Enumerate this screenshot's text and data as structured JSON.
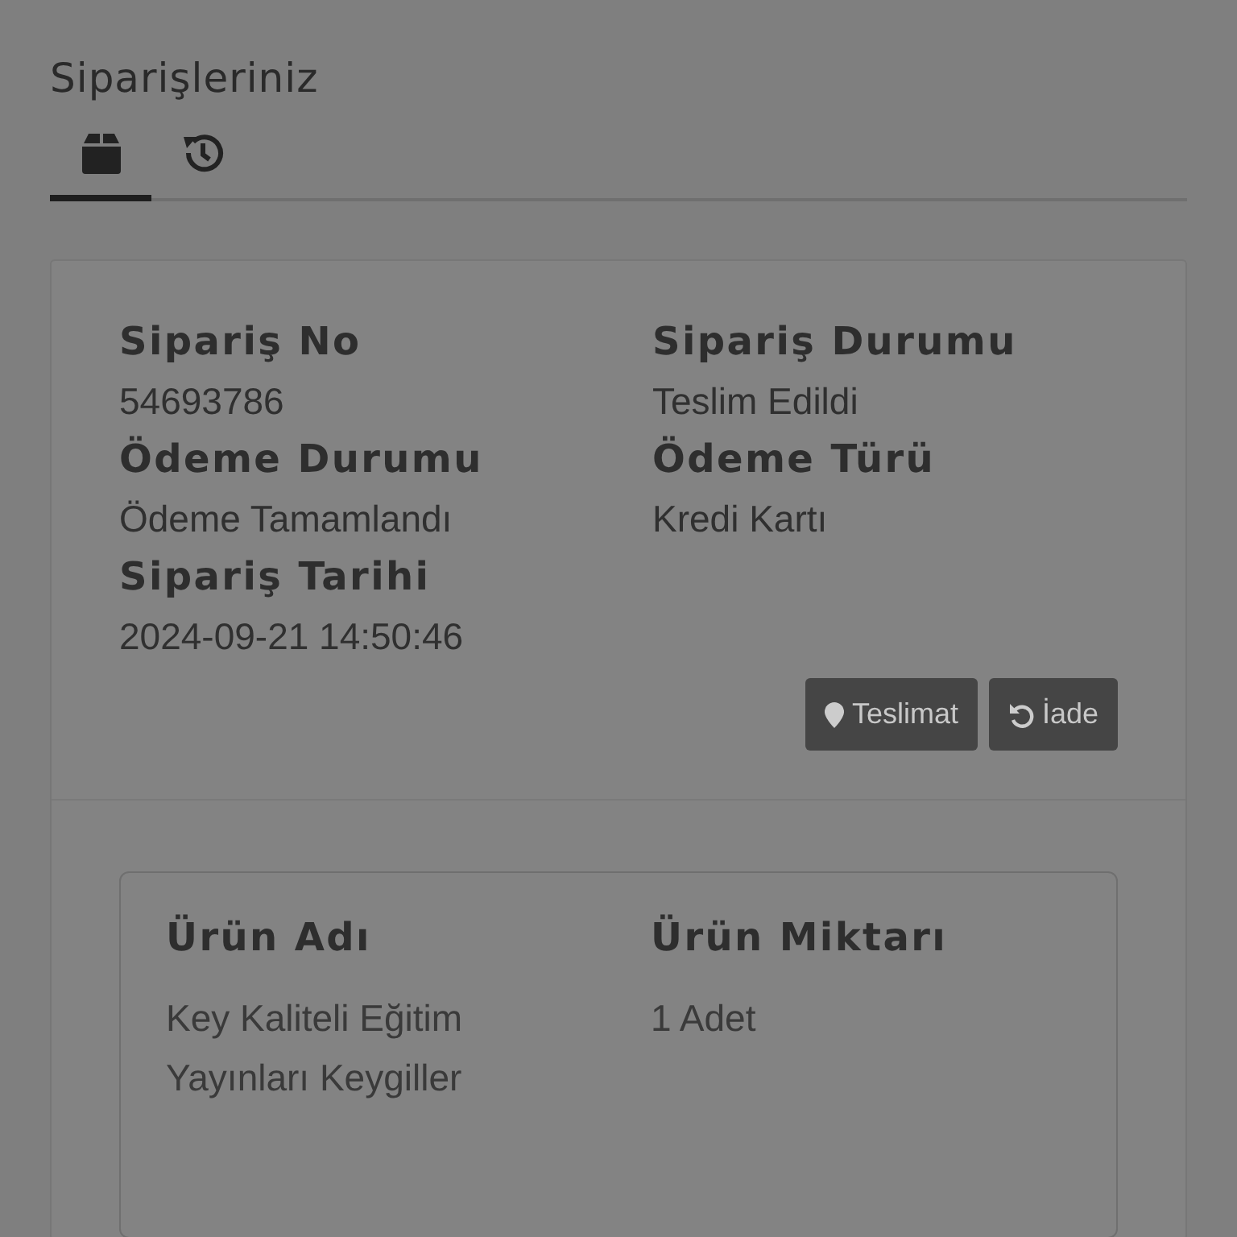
{
  "title": "Siparişleriniz",
  "tabs": [
    {
      "kind": "box",
      "selected": true
    },
    {
      "kind": "history",
      "selected": false
    }
  ],
  "order": {
    "fields": [
      {
        "label": "Sipariş No",
        "value": "54693786"
      },
      {
        "label": "Sipariş Durumu",
        "value": "Teslim Edildi"
      },
      {
        "label": "Ödeme Durumu",
        "value": "Ödeme Tamamlandı"
      },
      {
        "label": "Ödeme Türü",
        "value": "Kredi Kartı"
      },
      {
        "label": "Sipariş Tarihi",
        "value": "2024-09-21 14:50:46"
      }
    ],
    "buttons": [
      {
        "kind": "pin",
        "label": "Teslimat"
      },
      {
        "kind": "undo",
        "label": "İade"
      }
    ]
  },
  "products": {
    "columns": [
      "Ürün Adı",
      "Ürün Miktarı"
    ],
    "rows": [
      [
        "Key Kaliteli Eğitim Yayınları Keygiller",
        "1 Adet"
      ]
    ]
  }
}
